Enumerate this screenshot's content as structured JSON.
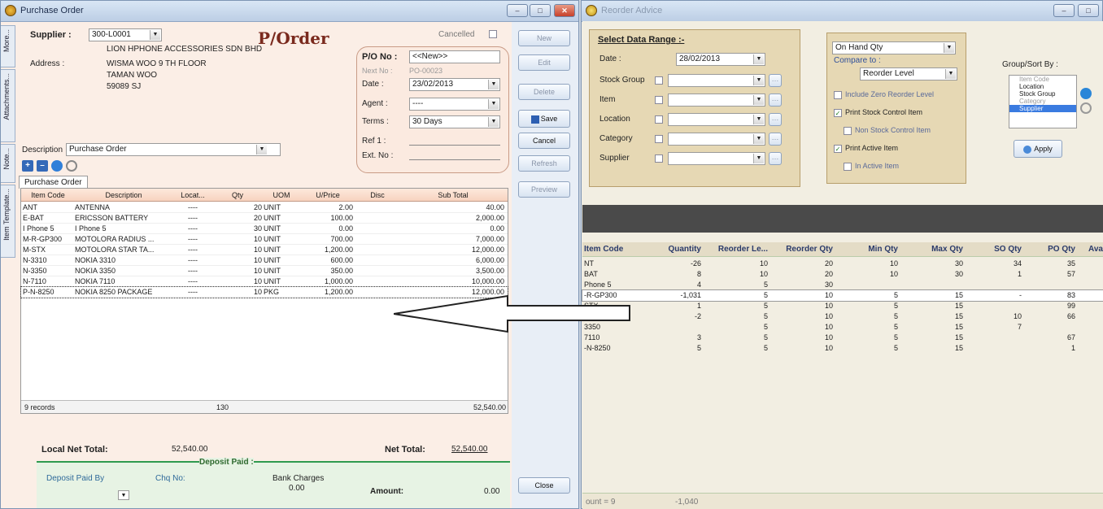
{
  "po_window": {
    "title": "Purchase Order",
    "side_tabs": [
      "More...",
      "Attachments...",
      "Note...",
      "Item Template..."
    ],
    "header": {
      "doc_title": "P/Order",
      "cancelled_label": "Cancelled",
      "supplier_label": "Supplier :",
      "supplier_code": "300-L0001",
      "supplier_name": "LION HPHONE ACCESSORIES SDN BHD",
      "address_label": "Address :",
      "address_lines": [
        "WISMA WOO 9 TH FLOOR",
        "TAMAN WOO",
        "59089 SJ"
      ],
      "description_label": "Description",
      "description_value": "Purchase Order",
      "po_no_label": "P/O No :",
      "po_no_value": "<<New>>",
      "next_no_label": "Next No :",
      "next_no_value": "PO-00023",
      "date_label": "Date :",
      "date_value": "23/02/2013",
      "agent_label": "Agent :",
      "agent_value": "----",
      "terms_label": "Terms :",
      "terms_value": "30 Days",
      "ref1_label": "Ref 1 :",
      "extno_label": "Ext. No :"
    },
    "tab_label": "Purchase Order",
    "columns": [
      "Item Code",
      "Description",
      "Locat...",
      "Qty",
      "UOM",
      "U/Price",
      "Disc",
      "Sub Total"
    ],
    "rows": [
      [
        "ANT",
        "ANTENNA",
        "----",
        "20",
        "UNIT",
        "2.00",
        "",
        "40.00"
      ],
      [
        "E-BAT",
        "ERICSSON BATTERY",
        "----",
        "20",
        "UNIT",
        "100.00",
        "",
        "2,000.00"
      ],
      [
        "I Phone 5",
        "I Phone 5",
        "----",
        "30",
        "UNIT",
        "0.00",
        "",
        "0.00"
      ],
      [
        "M-R-GP300",
        "MOTOLORA RADIUS ...",
        "----",
        "10",
        "UNIT",
        "700.00",
        "",
        "7,000.00"
      ],
      [
        "M-STX",
        "MOTOLORA STAR TA...",
        "----",
        "10",
        "UNIT",
        "1,200.00",
        "",
        "12,000.00"
      ],
      [
        "N-3310",
        "NOKIA 3310",
        "----",
        "10",
        "UNIT",
        "600.00",
        "",
        "6,000.00"
      ],
      [
        "N-3350",
        "NOKIA 3350",
        "----",
        "10",
        "UNIT",
        "350.00",
        "",
        "3,500.00"
      ],
      [
        "N-7110",
        "NOKIA 7110",
        "----",
        "10",
        "UNIT",
        "1,000.00",
        "",
        "10,000.00"
      ],
      [
        "P-N-8250",
        "NOKIA 8250 PACKAGE",
        "----",
        "10",
        "PKG",
        "1,200.00",
        "",
        "12,000.00"
      ]
    ],
    "footer": {
      "records": "9 records",
      "qty_total": "130",
      "sub_total": "52,540.00",
      "local_net_total_label": "Local Net Total:",
      "local_net_total_value": "52,540.00",
      "net_total_label": "Net Total:",
      "net_total_value": "52,540.00",
      "deposit_paid_label": "Deposit Paid :",
      "deposit_paid_by_label": "Deposit Paid By",
      "chq_no_label": "Chq No:",
      "bank_charges_label": "Bank Charges",
      "bank_charges_value": "0.00",
      "amount_label": "Amount:",
      "amount_value": "0.00"
    },
    "buttons": {
      "new": "New",
      "edit": "Edit",
      "delete": "Delete",
      "save": "Save",
      "cancel": "Cancel",
      "refresh": "Refresh",
      "preview": "Preview",
      "close": "Close"
    }
  },
  "ra_window": {
    "title": "Reorder Advice",
    "select_range_label": "Select Data Range :-",
    "date_label": "Date :",
    "date_value": "28/02/2013",
    "filters": [
      "Stock Group",
      "Item",
      "Location",
      "Category",
      "Supplier"
    ],
    "on_hand_value": "On Hand Qty",
    "compare_to_label": "Compare to :",
    "compare_to_value": "Reorder Level",
    "checks": [
      {
        "label": "Include Zero Reorder Level",
        "checked": false
      },
      {
        "label": "Print Stock Control Item",
        "checked": true
      },
      {
        "label": "Non Stock Control Item",
        "checked": false
      },
      {
        "label": "Print Active Item",
        "checked": true
      },
      {
        "label": "In Active Item",
        "checked": false
      }
    ],
    "group_sort_label": "Group/Sort By :",
    "group_items": [
      "Item Code",
      "Location",
      "Stock Group",
      "Category",
      "Supplier"
    ],
    "apply_label": "Apply",
    "columns": [
      "Item Code",
      "Quantity",
      "Reorder Le...",
      "Reorder Qty",
      "Min Qty",
      "Max Qty",
      "SO Qty",
      "PO Qty",
      "Ava"
    ],
    "rows": [
      [
        "NT",
        "-26",
        "10",
        "20",
        "10",
        "30",
        "34",
        "35",
        ""
      ],
      [
        "BAT",
        "8",
        "10",
        "20",
        "10",
        "30",
        "1",
        "57",
        ""
      ],
      [
        "Phone 5",
        "4",
        "5",
        "30",
        "",
        "",
        "",
        "",
        ""
      ],
      [
        "-R-GP300",
        "-1,031",
        "5",
        "10",
        "5",
        "15",
        "-",
        "83",
        ""
      ],
      [
        "STX",
        "1",
        "5",
        "10",
        "5",
        "15",
        "",
        "99",
        ""
      ],
      [
        "3310",
        "-2",
        "5",
        "10",
        "5",
        "15",
        "10",
        "66",
        ""
      ],
      [
        "3350",
        "",
        "5",
        "10",
        "5",
        "15",
        "7",
        "",
        ""
      ],
      [
        "7110",
        "3",
        "5",
        "10",
        "5",
        "15",
        "",
        "67",
        ""
      ],
      [
        "-N-8250",
        "5",
        "5",
        "10",
        "5",
        "15",
        "",
        "1",
        ""
      ]
    ],
    "footer_count": "ount = 9",
    "footer_total": "-1,040"
  }
}
